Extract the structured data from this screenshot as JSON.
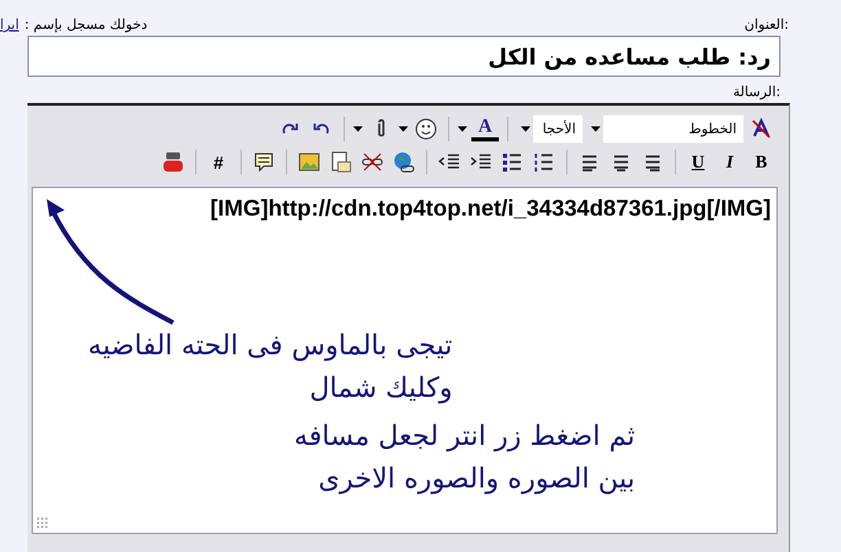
{
  "header": {
    "user_label": "دخولك مسجل بإسم :",
    "user_link": "ايرا",
    "title_label": "العنوان:"
  },
  "title_field": {
    "value": "رد: طلب مساعده من الكل"
  },
  "message_label": "الرسالة:",
  "toolbar": {
    "font_select": "الخطوط",
    "size_select": "الأحجا",
    "color_button": "A",
    "format_buttons": [
      "B",
      "I",
      "U"
    ],
    "tag_button": "#"
  },
  "editor": {
    "bbcode": "[IMG]http://cdn.top4top.net/i_34334d87361.jpg[/IMG]",
    "annotations": [
      {
        "lines": [
          "تيجى بالماوس فى الحته الفاضيه",
          "وكليك شمال"
        ]
      },
      {
        "lines": [
          "ثم اضغط زر انتر لجعل مسافه",
          "بين الصوره والصوره الاخرى"
        ]
      }
    ]
  }
}
